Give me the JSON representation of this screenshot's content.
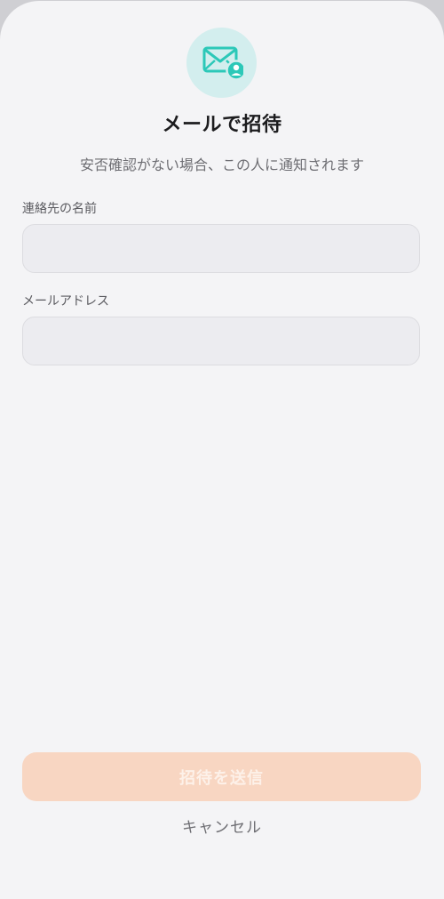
{
  "header": {
    "icon": "mail-person-icon",
    "title": "メールで招待",
    "subtitle": "安否確認がない場合、この人に通知されます"
  },
  "form": {
    "contact_name": {
      "label": "連絡先の名前",
      "value": "",
      "placeholder": ""
    },
    "email": {
      "label": "メールアドレス",
      "value": "",
      "placeholder": ""
    }
  },
  "actions": {
    "send_label": "招待を送信",
    "send_enabled": false,
    "cancel_label": "キャンセル"
  },
  "colors": {
    "accent": "#2cc8b8",
    "icon_bg": "#d3eeee",
    "send_disabled_bg": "#f8d6c2",
    "sheet_bg": "#f4f4f6"
  }
}
